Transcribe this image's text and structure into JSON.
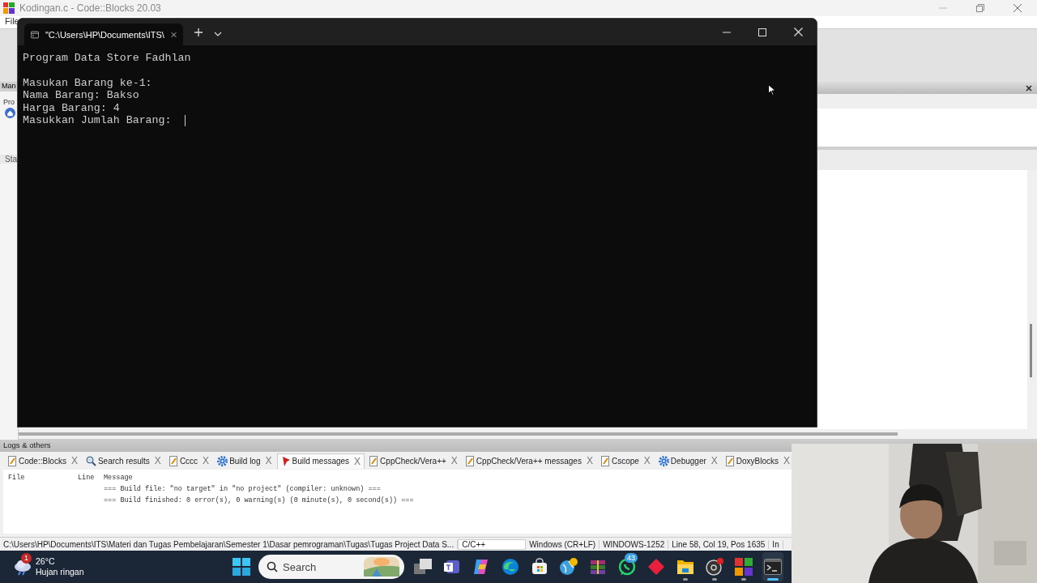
{
  "ide": {
    "title": "Kodingan.c - Code::Blocks 20.03",
    "menu": [
      "File"
    ],
    "left_panel": {
      "tab": "Man",
      "item": "Pro",
      "tab2": "Sta"
    }
  },
  "terminal": {
    "tab_title": "\"C:\\Users\\HP\\Documents\\ITS\\",
    "header": "Program Data Store Fadhlan",
    "lines": [
      "Masukan Barang ke-1:",
      "Nama Barang: Bakso",
      "Harga Barang: 4",
      "Masukkan Jumlah Barang: "
    ]
  },
  "logs": {
    "title": "Logs & others",
    "tabs": [
      {
        "label": "Code::Blocks",
        "kind": "doc",
        "selected": false,
        "close": "X"
      },
      {
        "label": "Search results",
        "kind": "search",
        "selected": false,
        "close": "X"
      },
      {
        "label": "Cccc",
        "kind": "doc",
        "selected": false,
        "close": "X"
      },
      {
        "label": "Build log",
        "kind": "gear",
        "selected": false,
        "close": "X"
      },
      {
        "label": "Build messages",
        "kind": "pin",
        "selected": true,
        "close": "X"
      },
      {
        "label": "CppCheck/Vera++",
        "kind": "doc",
        "selected": false,
        "close": "X"
      },
      {
        "label": "CppCheck/Vera++ messages",
        "kind": "doc",
        "selected": false,
        "close": "X"
      },
      {
        "label": "Cscope",
        "kind": "doc",
        "selected": false,
        "close": "X"
      },
      {
        "label": "Debugger",
        "kind": "gear",
        "selected": false,
        "close": "X"
      },
      {
        "label": "DoxyBlocks",
        "kind": "doc",
        "selected": false,
        "close": "X"
      }
    ],
    "columns": [
      "File",
      "Line",
      "Message"
    ],
    "messages": [
      "=== Build file: \"no target\" in \"no project\" (compiler: unknown) ===",
      "=== Build finished: 0 error(s), 0 warning(s) (0 minute(s), 0 second(s)) ==="
    ]
  },
  "status_bar": [
    "C:\\Users\\HP\\Documents\\ITS\\Materi dan Tugas Pembelajaran\\Semester 1\\Dasar pemrograman\\Tugas\\Tugas Project Data S...",
    "C/C++",
    "Windows (CR+LF)",
    "WINDOWS-1252",
    "Line 58, Col 19, Pos 1635",
    "In"
  ],
  "taskbar": {
    "weather_badge": "1",
    "temperature": "26°C",
    "weather": "Hujan ringan",
    "search": {
      "placeholder": "Search"
    },
    "apps": [
      {
        "kind": "taskview",
        "running": false,
        "active": false
      },
      {
        "kind": "teams",
        "running": false,
        "active": false
      },
      {
        "kind": "copilot",
        "running": false,
        "active": false
      },
      {
        "kind": "edge",
        "running": false,
        "active": false
      },
      {
        "kind": "store",
        "running": false,
        "active": false
      },
      {
        "kind": "globe",
        "running": false,
        "active": false
      },
      {
        "kind": "archive",
        "running": false,
        "active": false
      },
      {
        "kind": "chat",
        "running": false,
        "active": false,
        "badge": "43"
      },
      {
        "kind": "diamond",
        "running": false,
        "active": false
      },
      {
        "kind": "folder",
        "running": true,
        "active": false
      },
      {
        "kind": "record",
        "running": true,
        "active": false
      },
      {
        "kind": "blocks",
        "running": true,
        "active": false
      },
      {
        "kind": "terminal",
        "running": true,
        "active": true
      }
    ]
  }
}
